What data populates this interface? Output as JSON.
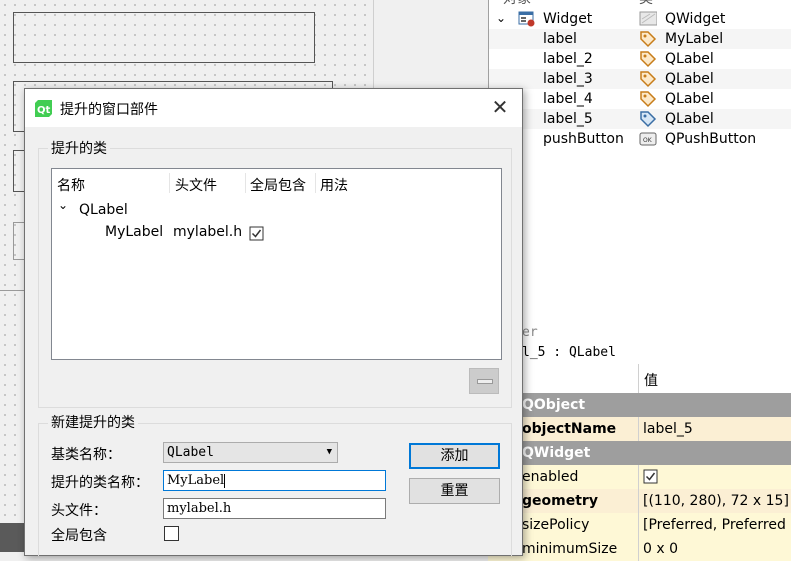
{
  "object_inspector": {
    "header_col1": "对象",
    "header_col2": "类",
    "rows": [
      {
        "name": "Widget",
        "class": "QWidget",
        "icon": "widget-form-icon"
      },
      {
        "name": "label",
        "class": "MyLabel",
        "icon": "label-tag-icon"
      },
      {
        "name": "label_2",
        "class": "QLabel",
        "icon": "label-tag-icon"
      },
      {
        "name": "label_3",
        "class": "QLabel",
        "icon": "label-tag-icon"
      },
      {
        "name": "label_4",
        "class": "QLabel",
        "icon": "label-tag-icon"
      },
      {
        "name": "label_5",
        "class": "QLabel",
        "icon": "label-tag-icon"
      },
      {
        "name": "pushButton",
        "class": "QPushButton",
        "icon": "pushbutton-icon"
      }
    ]
  },
  "property_editor": {
    "filter_placeholder": "er",
    "object_label": "l_5 : QLabel",
    "value_header": "值",
    "rows": [
      {
        "kind": "section",
        "name": "QObject"
      },
      {
        "kind": "prop",
        "name": "objectName",
        "value": "label_5",
        "bold": true
      },
      {
        "kind": "section",
        "name": "QWidget"
      },
      {
        "kind": "prop",
        "name": "enabled",
        "value": "",
        "checkbox": true
      },
      {
        "kind": "prop",
        "name": "geometry",
        "value": "[(110, 280), 72 x 15]",
        "bold": true
      },
      {
        "kind": "prop",
        "name": "sizePolicy",
        "value": "[Preferred, Preferred"
      },
      {
        "kind": "prop",
        "name": "minimumSize",
        "value": "0 x 0"
      }
    ]
  },
  "dialog": {
    "title": "提升的窗口部件",
    "app_icon": "qt-logo-icon",
    "promoted_group_title": "提升的类",
    "tree_headers": [
      "名称",
      "头文件",
      "全局包含",
      "用法"
    ],
    "tree_parent": "QLabel",
    "tree_child": {
      "name": "MyLabel",
      "header": "mylabel.h",
      "global_include": true
    },
    "new_group_title": "新建提升的类",
    "base_class_label": "基类名称：",
    "base_class_value": "QLabel",
    "promoted_name_label": "提升的类名称：",
    "promoted_name_value": "MyLabel",
    "header_file_label": "头文件：",
    "header_file_value": "mylabel.h",
    "global_include_label": "全局包含",
    "add_button": "添加",
    "reset_button": "重置"
  },
  "colors": {
    "section_bg": "#9e9e9e",
    "highlight_row": "#fbefd4",
    "plain_row": "#fef8d6",
    "focus_border": "#0078d7"
  }
}
